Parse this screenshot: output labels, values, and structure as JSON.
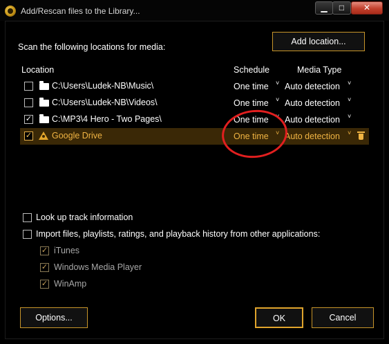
{
  "window": {
    "title": "Add/Rescan files to the Library..."
  },
  "controls": {
    "minimize": "▁",
    "maximize": "□",
    "close": "✕"
  },
  "scan_label": "Scan the following locations for media:",
  "add_location_label": "Add location...",
  "columns": {
    "location": "Location",
    "schedule": "Schedule",
    "media_type": "Media Type"
  },
  "rows": [
    {
      "checked": false,
      "icon": "folder-icon",
      "path": "C:\\Users\\Ludek-NB\\Music\\",
      "schedule": "One time",
      "media_type": "Auto detection",
      "check": ""
    },
    {
      "checked": false,
      "icon": "folder-icon",
      "path": "C:\\Users\\Ludek-NB\\Videos\\",
      "schedule": "One time",
      "media_type": "Auto detection",
      "check": ""
    },
    {
      "checked": true,
      "icon": "folder-icon",
      "path": "C:\\MP3\\4 Hero - Two Pages\\",
      "schedule": "One time",
      "media_type": "Auto detection",
      "check": "✓"
    },
    {
      "checked": true,
      "icon": "google-drive-icon",
      "path": "Google Drive",
      "schedule": "One time",
      "media_type": "Auto detection",
      "check": "✓",
      "selected": true
    }
  ],
  "dropdown_chevron": "˅",
  "options": {
    "lookup_label": "Look up track information",
    "lookup_checked": false,
    "import_label": "Import files, playlists, ratings, and playback history from other applications:",
    "import_checked": false,
    "apps": [
      {
        "label": "iTunes",
        "checked": true,
        "check": "✓"
      },
      {
        "label": "Windows Media Player",
        "checked": true,
        "check": "✓"
      },
      {
        "label": "WinAmp",
        "checked": true,
        "check": "✓"
      }
    ]
  },
  "buttons": {
    "options": "Options...",
    "ok": "OK",
    "cancel": "Cancel"
  },
  "colors": {
    "accent": "#c8952a",
    "selection_bg": "#3a2806",
    "selection_text": "#f0b443",
    "annotation": "#e11f1f"
  }
}
